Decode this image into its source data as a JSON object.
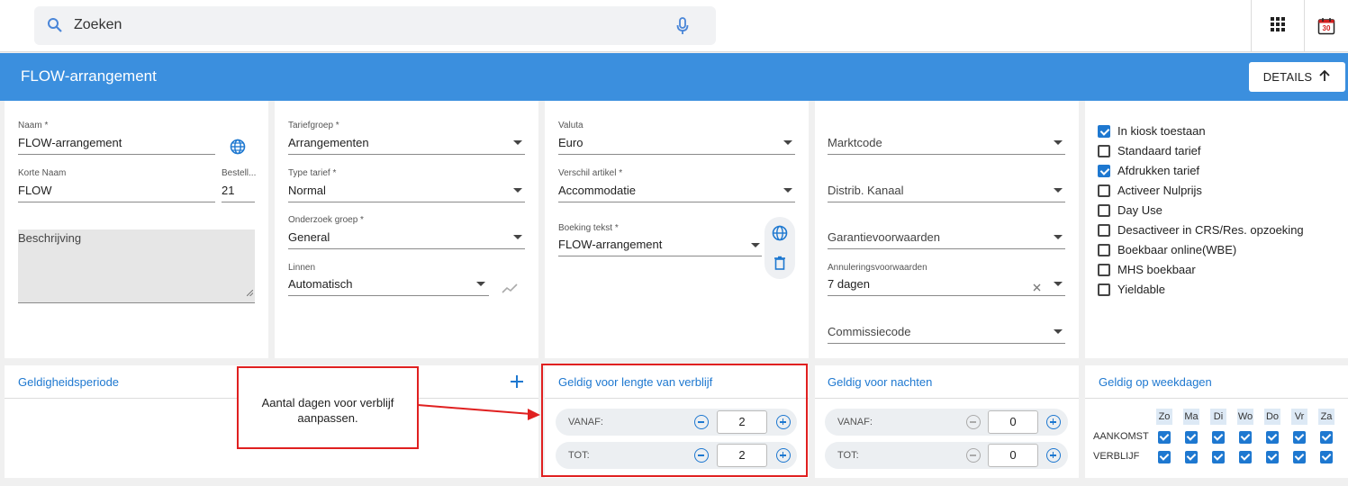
{
  "search": {
    "placeholder": "Zoeken"
  },
  "calendar": {
    "day": "30"
  },
  "header": {
    "title": "FLOW-arrangement",
    "details_label": "DETAILS"
  },
  "algemeen": {
    "naam_label": "Naam *",
    "naam_value": "FLOW-arrangement",
    "korte_naam_label": "Korte Naam",
    "korte_naam_value": "FLOW",
    "bestell_label": "Bestell...",
    "bestell_value": "21",
    "beschrijving_placeholder": "Beschrijving"
  },
  "details_tarief": {
    "tariefgroep_label": "Tariefgroep *",
    "tariefgroep_value": "Arrangementen",
    "type_label": "Type tarief *",
    "type_value": "Normal",
    "onderzoek_label": "Onderzoek groep *",
    "onderzoek_value": "General",
    "linnen_label": "Linnen",
    "linnen_value": "Automatisch"
  },
  "facturatie": {
    "valuta_label": "Valuta",
    "valuta_value": "Euro",
    "verschil_label": "Verschil artikel *",
    "verschil_value": "Accommodatie",
    "boeking_label": "Boeking tekst *",
    "boeking_value": "FLOW-arrangement"
  },
  "informatie_boeking": {
    "marktcode": "Marktcode",
    "distrib": "Distrib. Kanaal",
    "garantie": "Garantievoorwaarden",
    "annulering_label": "Annuleringsvoorwaarden",
    "annulering_value": "7 dagen",
    "commissie": "Commissiecode"
  },
  "opties": {
    "items": [
      {
        "label": "In kiosk toestaan",
        "checked": true
      },
      {
        "label": "Standaard tarief",
        "checked": false
      },
      {
        "label": "Afdrukken tarief",
        "checked": true
      },
      {
        "label": "Activeer Nulprijs",
        "checked": false
      },
      {
        "label": "Day Use",
        "checked": false
      },
      {
        "label": "Desactiveer in CRS/Res. opzoeking",
        "checked": false
      },
      {
        "label": "Boekbaar online(WBE)",
        "checked": false
      },
      {
        "label": "MHS boekbaar",
        "checked": false
      },
      {
        "label": "Yieldable",
        "checked": false
      }
    ]
  },
  "geldigheidsperiode": {
    "title": "Geldigheidsperiode"
  },
  "callout": {
    "line1": "Aantal dagen voor verblijf",
    "line2": "aanpassen."
  },
  "lengte_verblijf": {
    "title": "Geldig voor lengte van verblijf",
    "vanaf_label": "VANAF:",
    "vanaf_value": "2",
    "tot_label": "TOT:",
    "tot_value": "2"
  },
  "nachten": {
    "title": "Geldig voor nachten",
    "vanaf_label": "VANAF:",
    "vanaf_value": "0",
    "tot_label": "TOT:",
    "tot_value": "0"
  },
  "weekdagen": {
    "title": "Geldig op weekdagen",
    "days": [
      "Zo",
      "Ma",
      "Di",
      "Wo",
      "Do",
      "Vr",
      "Za"
    ],
    "aankomst_label": "AANKOMST",
    "verblijf_label": "VERBLIJF"
  },
  "colors": {
    "header": "#3b8fde",
    "accent": "#1e78d0",
    "annotation": "#e02020"
  }
}
